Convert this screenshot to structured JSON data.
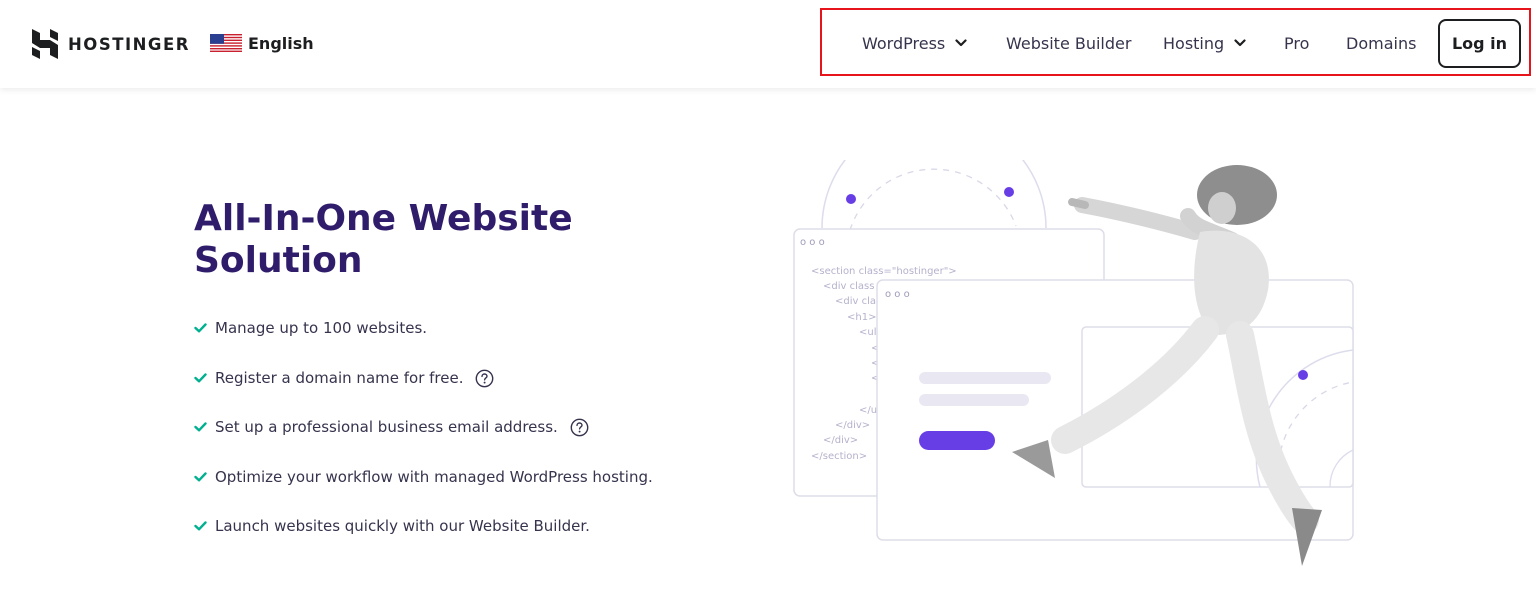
{
  "header": {
    "brand": "HOSTINGER",
    "language": "English",
    "nav": {
      "wordpress": "WordPress",
      "website_builder": "Website Builder",
      "hosting": "Hosting",
      "pro": "Pro",
      "domains": "Domains",
      "login": "Log in"
    }
  },
  "hero": {
    "title_line1": "All-In-One Website",
    "title_line2": "Solution",
    "features": [
      "Manage up to 100 websites.",
      "Register a domain name for free.",
      "Set up a professional business email address.",
      "Optimize your workflow with managed WordPress hosting.",
      "Launch websites quickly with our Website Builder."
    ]
  },
  "illustration": {
    "dots": "o o o",
    "code": [
      "<section class=\"hostinger\">",
      "<div class",
      "<div cla",
      "<h1>",
      "<ul",
      "<",
      "<",
      "<",
      "</u",
      "</div>",
      "</div>",
      "</section>"
    ]
  },
  "colors": {
    "brand_purple": "#673de6",
    "title": "#2f1c6a",
    "check_green": "#00b090",
    "nav_highlight": "#e8141b"
  },
  "icons": [
    "hostinger-logo-icon",
    "us-flag-icon",
    "chevron-down-icon",
    "check-icon",
    "help-circle-icon"
  ]
}
